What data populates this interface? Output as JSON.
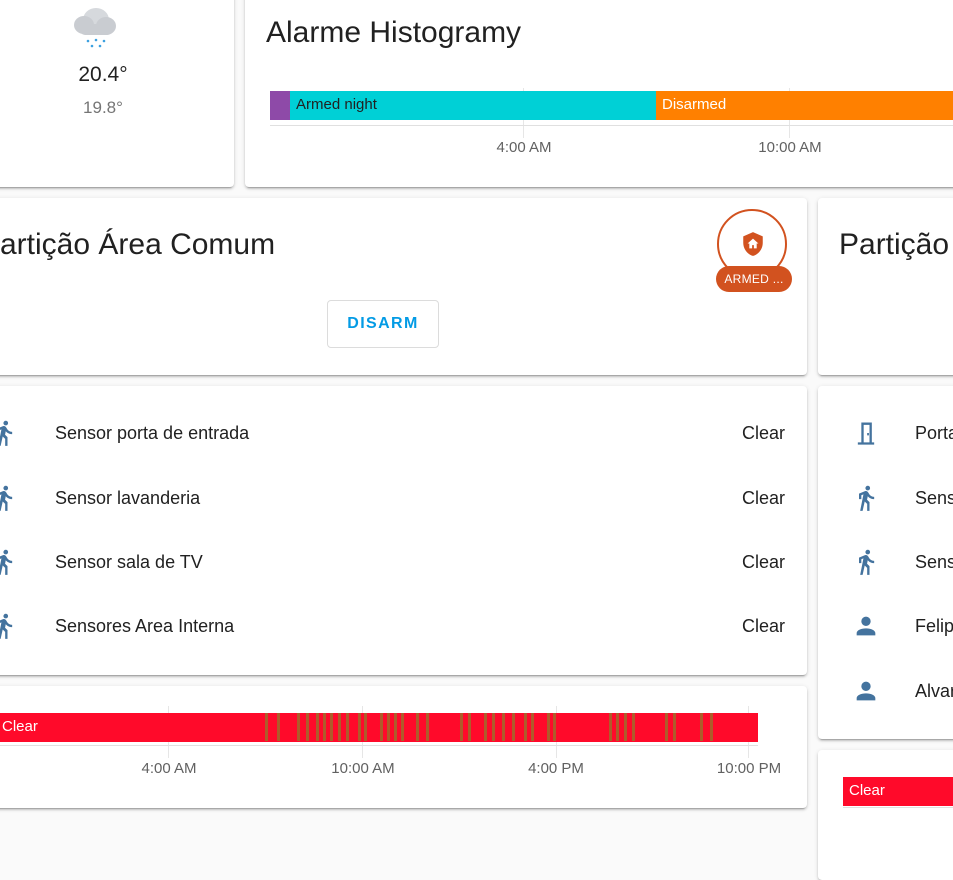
{
  "weather": {
    "icon": "cloud-rain-icon",
    "temperature": "20.4°",
    "low": "19.8°"
  },
  "alarm_history": {
    "title": "Alarme Histogramy",
    "segments": [
      {
        "label": "",
        "color": "#8e4aa8"
      },
      {
        "label": "Armed night",
        "color": "#00d0d6"
      },
      {
        "label": "Disarmed",
        "color": "#ff8000"
      }
    ],
    "ticks": [
      "4:00 AM",
      "10:00 AM"
    ]
  },
  "partition_common": {
    "title": "artição Área Comum",
    "badge_icon": "shield-home-icon",
    "badge_state": "ARMED ...",
    "disarm_label": "DISARM"
  },
  "partition_right": {
    "title": "Partição"
  },
  "sensors_left": [
    {
      "icon": "walk-icon",
      "name": "Sensor porta de entrada",
      "state": "Clear"
    },
    {
      "icon": "walk-icon",
      "name": "Sensor lavanderia",
      "state": "Clear"
    },
    {
      "icon": "walk-icon",
      "name": "Sensor sala de TV",
      "state": "Clear"
    },
    {
      "icon": "walk-icon",
      "name": "Sensores Area Interna",
      "state": "Clear"
    }
  ],
  "sensors_right": [
    {
      "icon": "door-icon",
      "name": "Porta"
    },
    {
      "icon": "walk-icon",
      "name": "Sens"
    },
    {
      "icon": "walk-icon",
      "name": "Sens"
    },
    {
      "icon": "account-icon",
      "name": "Felip"
    },
    {
      "icon": "account-icon",
      "name": "Alvar"
    }
  ],
  "sensor_history": {
    "state_label": "Clear",
    "color": "#ff0a2a",
    "stripe_color": "#a5652a",
    "ticks": [
      "4:00 AM",
      "10:00 AM",
      "4:00 PM",
      "10:00 PM"
    ]
  },
  "sensor_history_right": {
    "state_label": "Clear",
    "color": "#ff0a2a"
  }
}
